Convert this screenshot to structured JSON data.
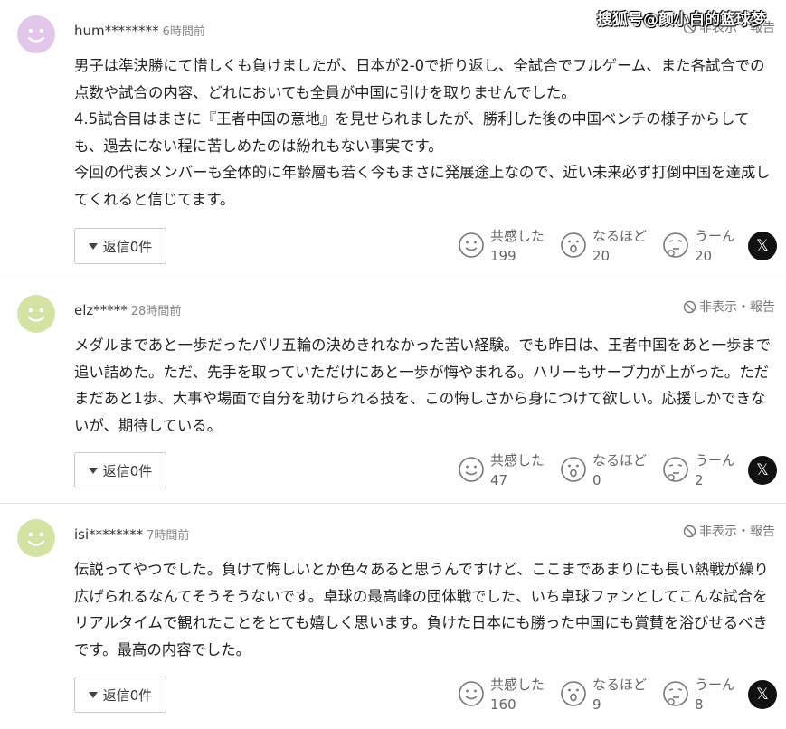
{
  "watermark": "搜狐号@颜小白的篮球梦",
  "comments": [
    {
      "user": "hum********",
      "time": "6時間前",
      "hide_label": "非表示・報告",
      "body": "男子は準決勝にて惜しくも負けましたが、日本が2-0で折り返し、全試合でフルゲーム、また各試合での点数や試合の内容、どれにおいても全員が中国に引けを取りませんでした。\n4.5試合目はまさに『王者中国の意地』を見せられましたが、勝利した後の中国ベンチの様子からしても、過去にない程に苦しめたのは紛れもない事実です。\n今回の代表メンバーも全体的に年齢層も若く今もまさに発展途上なので、近い未来必ず打倒中国を達成してくれると信じてます。",
      "reply_label": "返信0件",
      "reactions": [
        {
          "label": "共感した",
          "count": "199"
        },
        {
          "label": "なるほど",
          "count": "20"
        },
        {
          "label": "うーん",
          "count": "20"
        }
      ],
      "avatar_color": "#e3c7ea"
    },
    {
      "user": "elz*****",
      "time": "28時間前",
      "hide_label": "非表示・報告",
      "body": "メダルまであと一歩だったパリ五輪の決めきれなかった苦い経験。でも昨日は、王者中国をあと一歩まで追い詰めた。ただ、先手を取っていただけにあと一歩が悔やまれる。ハリーもサーブ力が上がった。ただまだあと1歩、大事や場面で自分を助けられる技を、この悔しさから身につけて欲しい。応援しかできないが、期待している。",
      "reply_label": "返信0件",
      "reactions": [
        {
          "label": "共感した",
          "count": "47"
        },
        {
          "label": "なるほど",
          "count": "0"
        },
        {
          "label": "うーん",
          "count": "2"
        }
      ],
      "avatar_color": "#d4e3a4"
    },
    {
      "user": "isi********",
      "time": "7時間前",
      "hide_label": "非表示・報告",
      "body": "伝説ってやつでした。負けて悔しいとか色々あると思うんですけど、ここまであまりにも長い熱戦が繰り広げられるなんてそうそうないです。卓球の最高峰の団体戦でした、いち卓球ファンとしてこんな試合をリアルタイムで観れたことをとても嬉しく思います。負けた日本にも勝った中国にも賞賛を浴びせるべきです。最高の内容でした。",
      "reply_label": "返信0件",
      "reactions": [
        {
          "label": "共感した",
          "count": "160"
        },
        {
          "label": "なるほど",
          "count": "9"
        },
        {
          "label": "うーん",
          "count": "8"
        }
      ],
      "avatar_color": "#d4e3a4"
    }
  ],
  "share": {
    "icon": "x-icon",
    "glyph": "𝕏"
  }
}
